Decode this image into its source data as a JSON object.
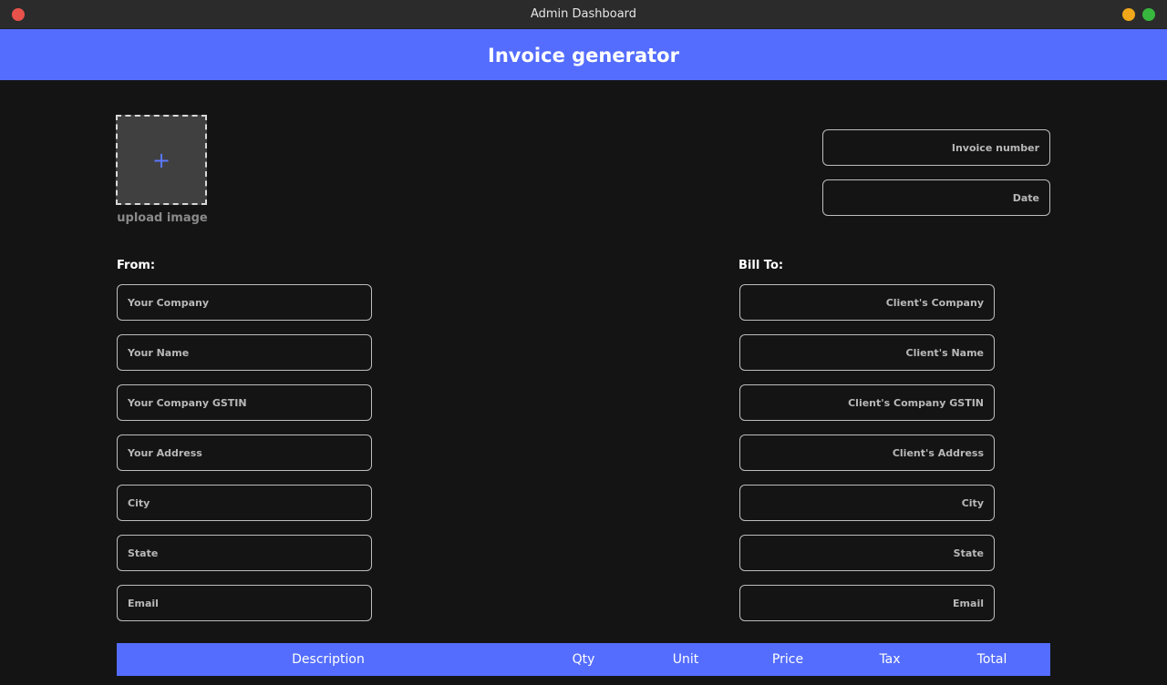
{
  "window": {
    "title": "Admin Dashboard"
  },
  "header": {
    "title": "Invoice generator"
  },
  "upload": {
    "icon": "plus-icon",
    "plus_glyph": "+",
    "label": "upload image"
  },
  "invoice": {
    "number_placeholder": "Invoice number",
    "date_placeholder": "Date"
  },
  "from": {
    "label": "From:",
    "fields": [
      "Your Company",
      "Your Name",
      "Your Company GSTIN",
      "Your Address",
      "City",
      "State",
      "Email"
    ]
  },
  "bill_to": {
    "label": "Bill To:",
    "fields": [
      "Client's Company",
      "Client's Name",
      "Client's Company GSTIN",
      "Client's Address",
      "City",
      "State",
      "Email"
    ]
  },
  "table": {
    "columns": [
      "Description",
      "Qty",
      "Unit",
      "Price",
      "Tax",
      "Total"
    ]
  },
  "colors": {
    "accent": "#546dff",
    "background": "#141414",
    "titlebar": "#2b2b2b"
  }
}
